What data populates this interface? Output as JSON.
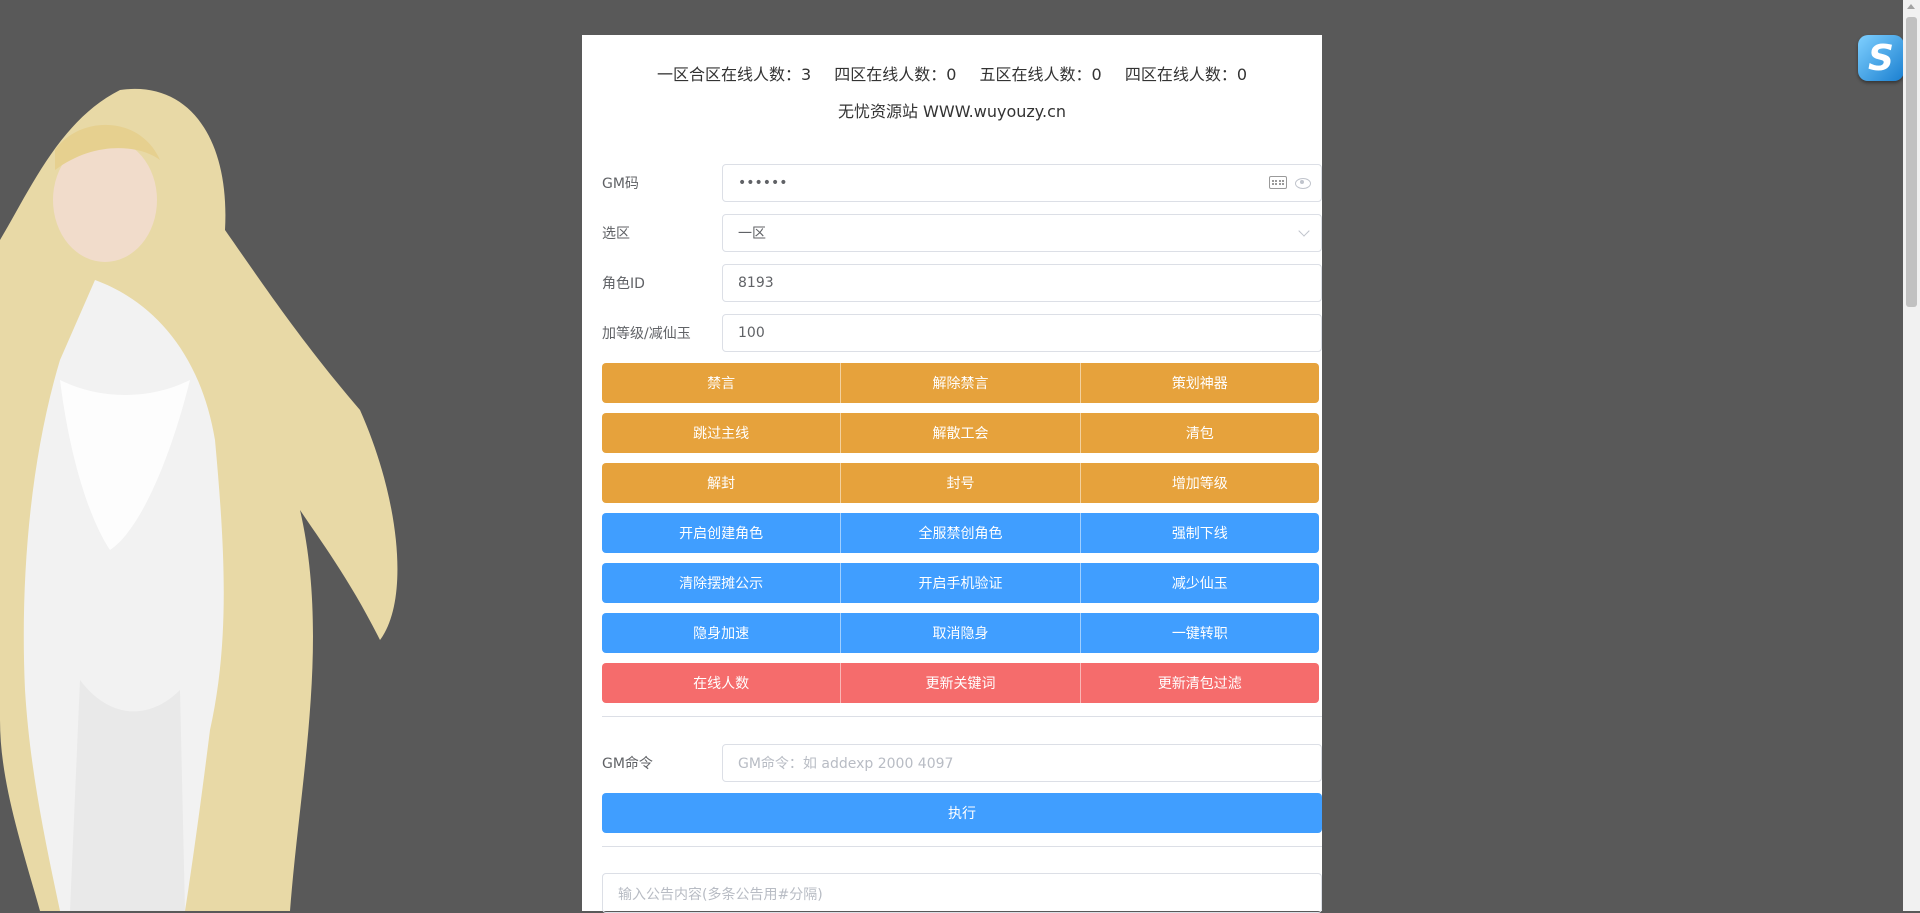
{
  "header": {
    "stats": [
      "一区合区在线人数：3",
      "四区在线人数：0",
      "五区在线人数：0",
      "四区在线人数：0"
    ],
    "site": "无忧资源站 WWW.wuyouzy.cn"
  },
  "form": {
    "gm_code": {
      "label": "GM码",
      "value": "••••••"
    },
    "zone": {
      "label": "选区",
      "value": "一区"
    },
    "role_id": {
      "label": "角色ID",
      "value": "8193"
    },
    "amount": {
      "label": "加等级/减仙玉",
      "value": "100"
    }
  },
  "buttons": {
    "row1": [
      "禁言",
      "解除禁言",
      "策划神器"
    ],
    "row2": [
      "跳过主线",
      "解散工会",
      "清包"
    ],
    "row3": [
      "解封",
      "封号",
      "增加等级"
    ],
    "row4": [
      "开启创建角色",
      "全服禁创角色",
      "强制下线"
    ],
    "row5": [
      "清除摆摊公示",
      "开启手机验证",
      "减少仙玉"
    ],
    "row6": [
      "隐身加速",
      "取消隐身",
      "一键转职"
    ],
    "row7": [
      "在线人数",
      "更新关键词",
      "更新清包过滤"
    ]
  },
  "command": {
    "label": "GM命令",
    "placeholder": "GM命令：如 addexp 2000 4097",
    "execute": "执行"
  },
  "notice": {
    "placeholder": "输入公告内容(多条公告用#分隔)"
  },
  "logo": {
    "letter": "S"
  },
  "colors": {
    "orange": "#e6a23c",
    "blue": "#409eff",
    "red": "#f56c6c",
    "background": "#595959"
  }
}
